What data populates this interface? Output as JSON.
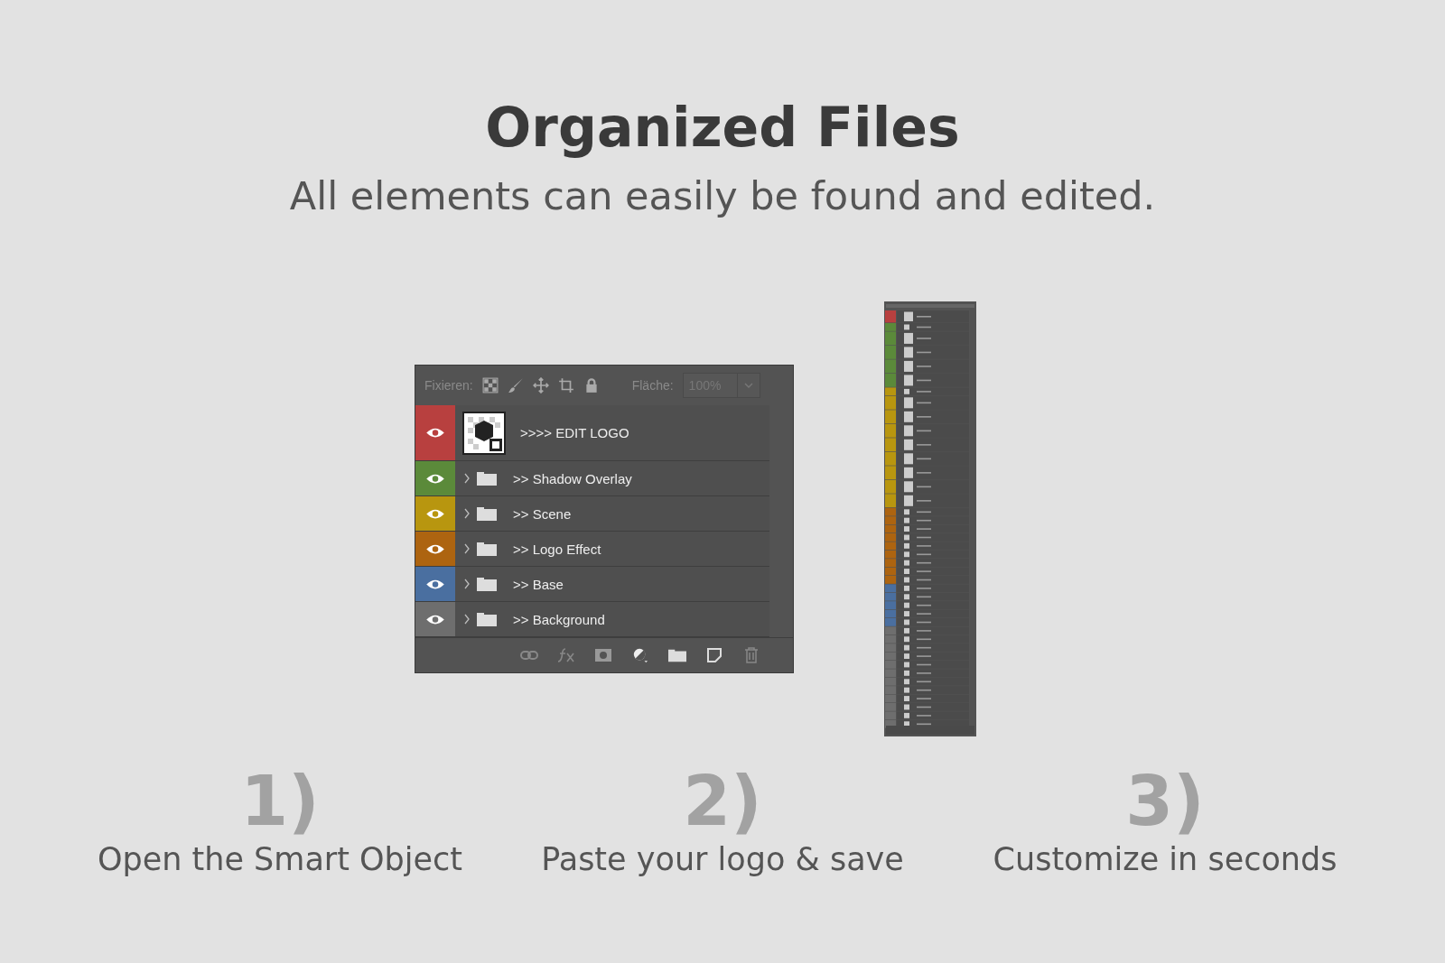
{
  "title": "Organized Files",
  "subtitle": "All elements can easily be found and edited.",
  "panel": {
    "lock_label": "Fixieren:",
    "fill_label": "Fläche:",
    "fill_value": "100%",
    "layers": [
      {
        "name": ">>>> EDIT LOGO",
        "color": "#b8403f",
        "kind": "smart"
      },
      {
        "name": ">> Shadow Overlay",
        "color": "#5b8a3a",
        "kind": "group"
      },
      {
        "name": ">> Scene",
        "color": "#b8960f",
        "kind": "group"
      },
      {
        "name": ">> Logo Effect",
        "color": "#ad6410",
        "kind": "group"
      },
      {
        "name": ">> Base",
        "color": "#4a6fa0",
        "kind": "group"
      },
      {
        "name": ">> Background",
        "color": "#6e6e6e",
        "kind": "group"
      }
    ]
  },
  "steps": [
    {
      "number": "1)",
      "label": "Open the Smart Object"
    },
    {
      "number": "2)",
      "label": "Paste your logo & save"
    },
    {
      "number": "3)",
      "label": "Customize in seconds"
    }
  ]
}
